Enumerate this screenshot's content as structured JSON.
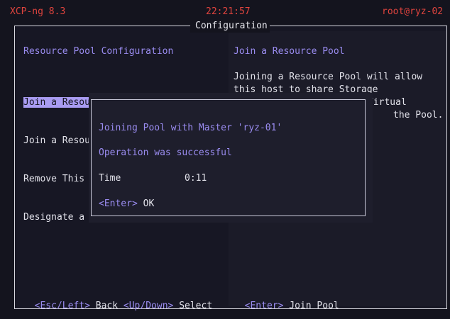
{
  "header": {
    "app": "XCP-ng 8.3",
    "time": "22:21:57",
    "user": "root@ryz-02"
  },
  "frame_title": "Configuration",
  "left_pane": {
    "heading": "Resource Pool Configuration",
    "items": [
      "Join a Resource Pool",
      "Join a Resource Pool (Forced)",
      "Remove This",
      "Designate a"
    ]
  },
  "right_pane": {
    "heading": "Join a Resource Pool",
    "description_lines": [
      "Joining a Resource Pool will allow",
      "this host to share Storage",
      "Virtual",
      "the Pool."
    ]
  },
  "dialog": {
    "title": "Joining Pool with Master 'ryz-01'",
    "status": "Operation was successful",
    "time_label": "Time",
    "time_value": "0:11",
    "key": "<Enter>",
    "key_action": "OK"
  },
  "footer": {
    "left": [
      {
        "key": "<Esc/Left>",
        "action": "Back"
      },
      {
        "key": "<Up/Down>",
        "action": "Select"
      }
    ],
    "right": {
      "key": "<Enter>",
      "action": "Join Pool"
    }
  },
  "colors": {
    "accent": "#9a8cf0",
    "header": "#e0443e",
    "selection": "#a99cf2"
  }
}
